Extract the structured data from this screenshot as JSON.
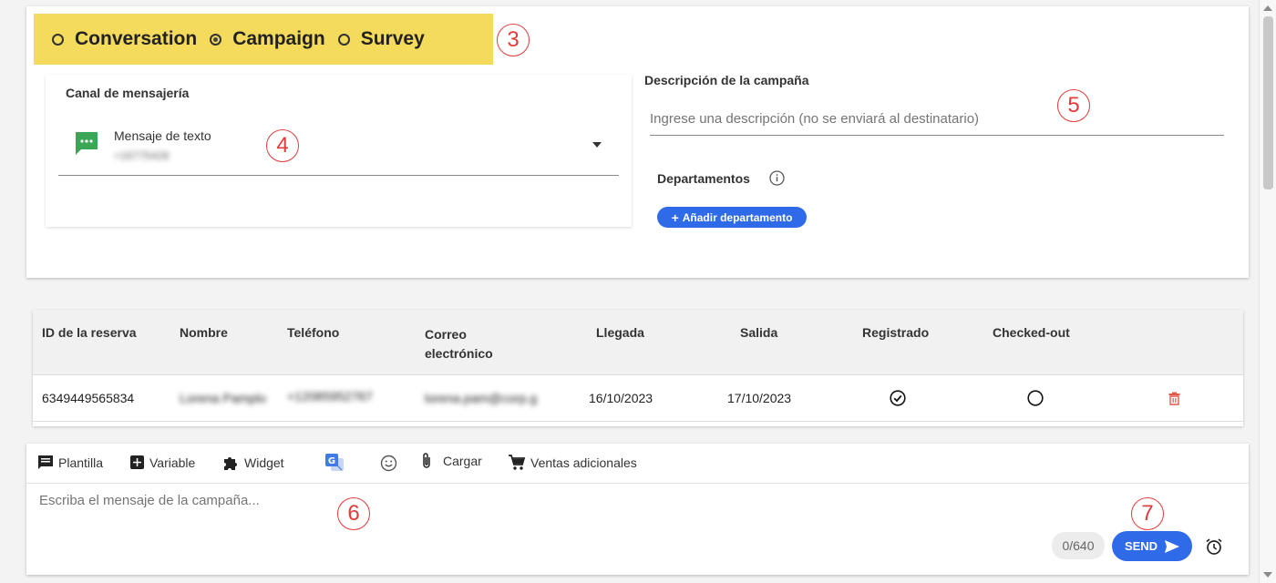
{
  "campaign_type": {
    "options": [
      {
        "label": "Conversation",
        "selected": false
      },
      {
        "label": "Campaign",
        "selected": true
      },
      {
        "label": "Survey",
        "selected": false
      }
    ]
  },
  "callouts": [
    "3",
    "4",
    "5",
    "6",
    "7"
  ],
  "channel": {
    "label": "Canal de mensajería",
    "name": "Mensaje de texto",
    "number": "+16775428"
  },
  "description": {
    "label": "Descripción de la campaña",
    "placeholder": "Ingrese una descripción (no se enviará al destinatario)"
  },
  "departments": {
    "label": "Departamentos",
    "add_label": "Añadir departamento"
  },
  "reservations": {
    "columns": [
      "ID de la reserva",
      "Nombre",
      "Teléfono",
      "Correo electrónico",
      "Llegada",
      "Salida",
      "Registrado",
      "Checked-out"
    ],
    "rows": [
      {
        "id": "6349449565834",
        "name": "Lorena Pamplo",
        "phone": "+12085952767",
        "email": "lorena.pam@corp.g",
        "arrival": "16/10/2023",
        "departure": "17/10/2023"
      }
    ]
  },
  "composer": {
    "tools": {
      "template": "Plantilla",
      "variable": "Variable",
      "widget": "Widget",
      "upload": "Cargar",
      "upsell": "Ventas adicionales"
    },
    "placeholder": "Escriba el mensaje de la campaña...",
    "char_count": "0/640",
    "send_label": "SEND"
  },
  "colors": {
    "highlight": "#f5db5b",
    "accent": "#2f6be8",
    "callout": "#e23b3b",
    "sms_green": "#3aa757",
    "delete_red": "#e25a4a"
  }
}
